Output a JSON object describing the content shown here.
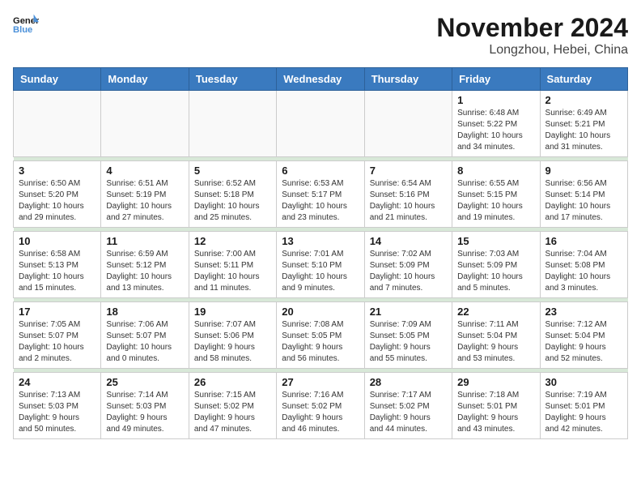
{
  "logo": {
    "line1": "General",
    "line2": "Blue"
  },
  "title": "November 2024",
  "location": "Longzhou, Hebei, China",
  "weekdays": [
    "Sunday",
    "Monday",
    "Tuesday",
    "Wednesday",
    "Thursday",
    "Friday",
    "Saturday"
  ],
  "weeks": [
    [
      {
        "day": "",
        "info": ""
      },
      {
        "day": "",
        "info": ""
      },
      {
        "day": "",
        "info": ""
      },
      {
        "day": "",
        "info": ""
      },
      {
        "day": "",
        "info": ""
      },
      {
        "day": "1",
        "info": "Sunrise: 6:48 AM\nSunset: 5:22 PM\nDaylight: 10 hours\nand 34 minutes."
      },
      {
        "day": "2",
        "info": "Sunrise: 6:49 AM\nSunset: 5:21 PM\nDaylight: 10 hours\nand 31 minutes."
      }
    ],
    [
      {
        "day": "3",
        "info": "Sunrise: 6:50 AM\nSunset: 5:20 PM\nDaylight: 10 hours\nand 29 minutes."
      },
      {
        "day": "4",
        "info": "Sunrise: 6:51 AM\nSunset: 5:19 PM\nDaylight: 10 hours\nand 27 minutes."
      },
      {
        "day": "5",
        "info": "Sunrise: 6:52 AM\nSunset: 5:18 PM\nDaylight: 10 hours\nand 25 minutes."
      },
      {
        "day": "6",
        "info": "Sunrise: 6:53 AM\nSunset: 5:17 PM\nDaylight: 10 hours\nand 23 minutes."
      },
      {
        "day": "7",
        "info": "Sunrise: 6:54 AM\nSunset: 5:16 PM\nDaylight: 10 hours\nand 21 minutes."
      },
      {
        "day": "8",
        "info": "Sunrise: 6:55 AM\nSunset: 5:15 PM\nDaylight: 10 hours\nand 19 minutes."
      },
      {
        "day": "9",
        "info": "Sunrise: 6:56 AM\nSunset: 5:14 PM\nDaylight: 10 hours\nand 17 minutes."
      }
    ],
    [
      {
        "day": "10",
        "info": "Sunrise: 6:58 AM\nSunset: 5:13 PM\nDaylight: 10 hours\nand 15 minutes."
      },
      {
        "day": "11",
        "info": "Sunrise: 6:59 AM\nSunset: 5:12 PM\nDaylight: 10 hours\nand 13 minutes."
      },
      {
        "day": "12",
        "info": "Sunrise: 7:00 AM\nSunset: 5:11 PM\nDaylight: 10 hours\nand 11 minutes."
      },
      {
        "day": "13",
        "info": "Sunrise: 7:01 AM\nSunset: 5:10 PM\nDaylight: 10 hours\nand 9 minutes."
      },
      {
        "day": "14",
        "info": "Sunrise: 7:02 AM\nSunset: 5:09 PM\nDaylight: 10 hours\nand 7 minutes."
      },
      {
        "day": "15",
        "info": "Sunrise: 7:03 AM\nSunset: 5:09 PM\nDaylight: 10 hours\nand 5 minutes."
      },
      {
        "day": "16",
        "info": "Sunrise: 7:04 AM\nSunset: 5:08 PM\nDaylight: 10 hours\nand 3 minutes."
      }
    ],
    [
      {
        "day": "17",
        "info": "Sunrise: 7:05 AM\nSunset: 5:07 PM\nDaylight: 10 hours\nand 2 minutes."
      },
      {
        "day": "18",
        "info": "Sunrise: 7:06 AM\nSunset: 5:07 PM\nDaylight: 10 hours\nand 0 minutes."
      },
      {
        "day": "19",
        "info": "Sunrise: 7:07 AM\nSunset: 5:06 PM\nDaylight: 9 hours\nand 58 minutes."
      },
      {
        "day": "20",
        "info": "Sunrise: 7:08 AM\nSunset: 5:05 PM\nDaylight: 9 hours\nand 56 minutes."
      },
      {
        "day": "21",
        "info": "Sunrise: 7:09 AM\nSunset: 5:05 PM\nDaylight: 9 hours\nand 55 minutes."
      },
      {
        "day": "22",
        "info": "Sunrise: 7:11 AM\nSunset: 5:04 PM\nDaylight: 9 hours\nand 53 minutes."
      },
      {
        "day": "23",
        "info": "Sunrise: 7:12 AM\nSunset: 5:04 PM\nDaylight: 9 hours\nand 52 minutes."
      }
    ],
    [
      {
        "day": "24",
        "info": "Sunrise: 7:13 AM\nSunset: 5:03 PM\nDaylight: 9 hours\nand 50 minutes."
      },
      {
        "day": "25",
        "info": "Sunrise: 7:14 AM\nSunset: 5:03 PM\nDaylight: 9 hours\nand 49 minutes."
      },
      {
        "day": "26",
        "info": "Sunrise: 7:15 AM\nSunset: 5:02 PM\nDaylight: 9 hours\nand 47 minutes."
      },
      {
        "day": "27",
        "info": "Sunrise: 7:16 AM\nSunset: 5:02 PM\nDaylight: 9 hours\nand 46 minutes."
      },
      {
        "day": "28",
        "info": "Sunrise: 7:17 AM\nSunset: 5:02 PM\nDaylight: 9 hours\nand 44 minutes."
      },
      {
        "day": "29",
        "info": "Sunrise: 7:18 AM\nSunset: 5:01 PM\nDaylight: 9 hours\nand 43 minutes."
      },
      {
        "day": "30",
        "info": "Sunrise: 7:19 AM\nSunset: 5:01 PM\nDaylight: 9 hours\nand 42 minutes."
      }
    ]
  ]
}
